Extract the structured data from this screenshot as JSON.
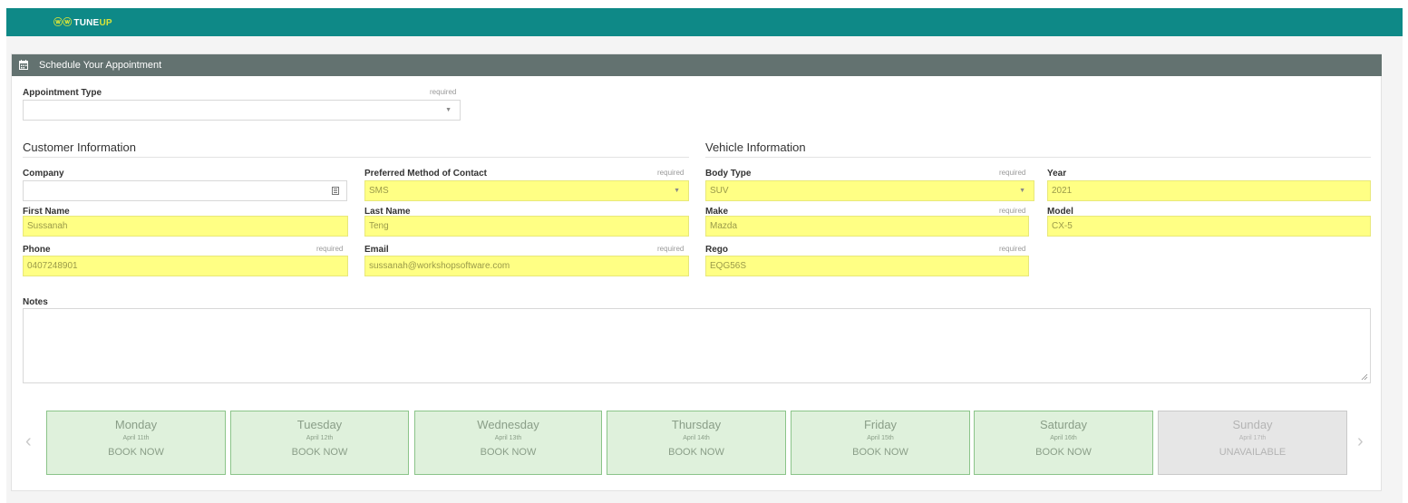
{
  "header": {
    "logo_mark": "ⓦⓦ",
    "logo_text": "TUNE",
    "logo_text_accent": "UP"
  },
  "panel": {
    "title": "Schedule Your Appointment"
  },
  "appointment_type": {
    "label": "Appointment Type",
    "required": "required",
    "value": ""
  },
  "customer": {
    "heading": "Customer Information",
    "company": {
      "label": "Company",
      "value": ""
    },
    "contact_method": {
      "label": "Preferred Method of Contact",
      "required": "required",
      "value": "SMS"
    },
    "first_name": {
      "label": "First Name",
      "value": "Sussanah"
    },
    "last_name": {
      "label": "Last Name",
      "value": "Teng"
    },
    "phone": {
      "label": "Phone",
      "required": "required",
      "value": "0407248901"
    },
    "email": {
      "label": "Email",
      "required": "required",
      "value": "sussanah@workshopsoftware.com"
    }
  },
  "vehicle": {
    "heading": "Vehicle Information",
    "body_type": {
      "label": "Body Type",
      "required": "required",
      "value": "SUV"
    },
    "year": {
      "label": "Year",
      "value": "2021"
    },
    "make": {
      "label": "Make",
      "required": "required",
      "value": "Mazda"
    },
    "model": {
      "label": "Model",
      "value": "CX-5"
    },
    "rego": {
      "label": "Rego",
      "required": "required",
      "value": "EQG56S"
    }
  },
  "notes": {
    "label": "Notes",
    "value": ""
  },
  "days": [
    {
      "name": "Monday",
      "date": "April 11th",
      "action": "BOOK NOW"
    },
    {
      "name": "Tuesday",
      "date": "April 12th",
      "action": "BOOK NOW"
    },
    {
      "name": "Wednesday",
      "date": "April 13th",
      "action": "BOOK NOW"
    },
    {
      "name": "Thursday",
      "date": "April 14th",
      "action": "BOOK NOW"
    },
    {
      "name": "Friday",
      "date": "April 15th",
      "action": "BOOK NOW"
    },
    {
      "name": "Saturday",
      "date": "April 16th",
      "action": "BOOK NOW"
    },
    {
      "name": "Sunday",
      "date": "April 17th",
      "action": "UNAVAILABLE"
    }
  ],
  "nav": {
    "prev_icon": "‹",
    "next_icon": "›"
  },
  "colors": {
    "brand_teal": "#0e8987",
    "panel_header": "#637270",
    "highlight": "#ffff84",
    "day_available": "#dff1dc",
    "day_unavailable": "#e6e6e6"
  }
}
